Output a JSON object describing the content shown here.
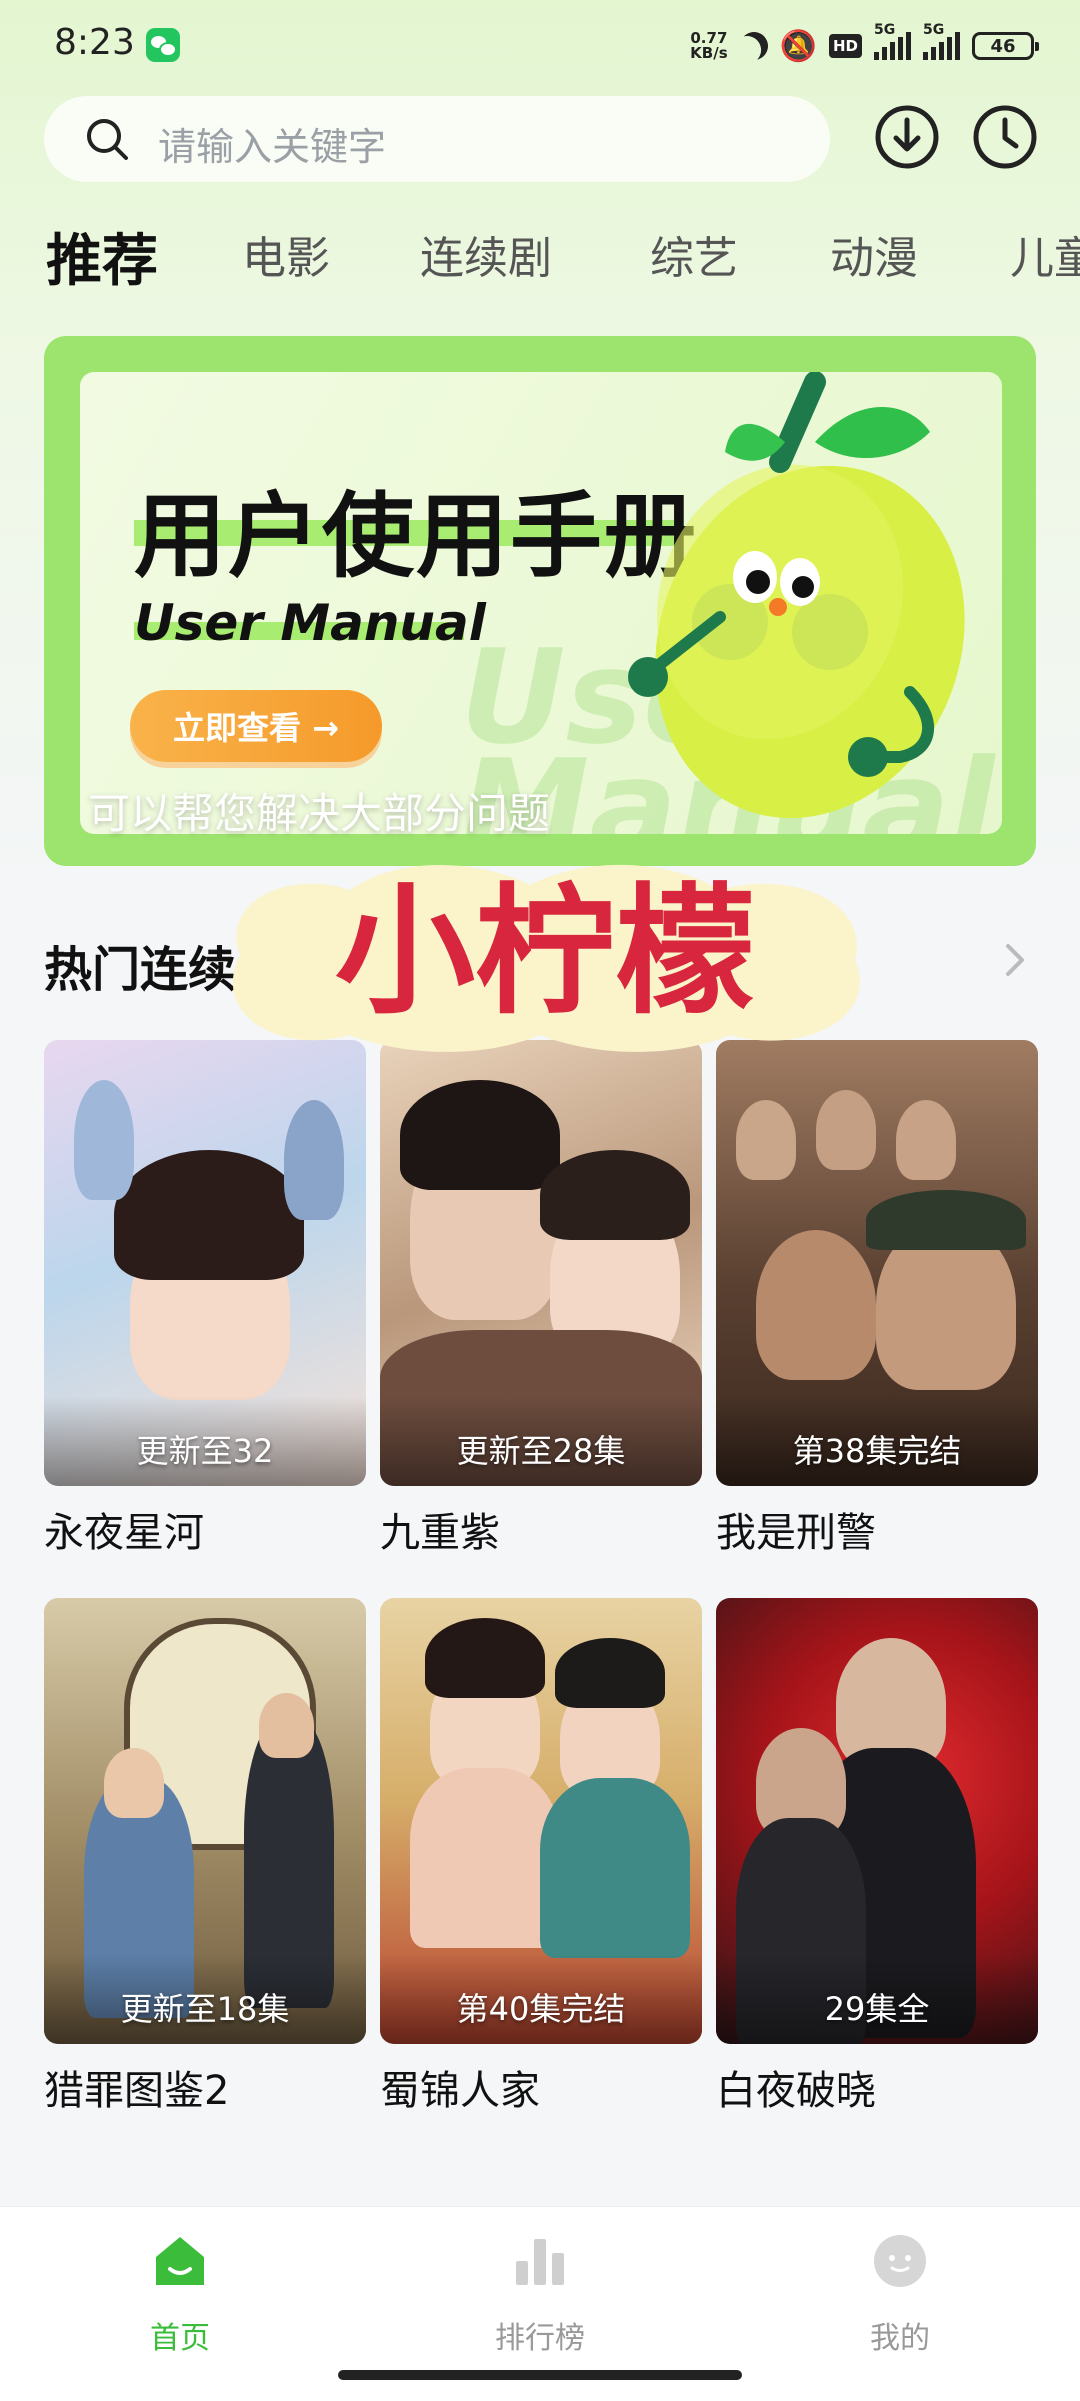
{
  "status_bar": {
    "time": "8:23",
    "net_speed_value": "0.77",
    "net_speed_unit": "KB/s",
    "hd_badge": "HD",
    "sim1": "5G",
    "sim2": "5G",
    "battery": "46"
  },
  "search": {
    "placeholder": "请输入关键字"
  },
  "header_actions": {
    "download_icon": "download-icon",
    "history_icon": "clock-icon"
  },
  "tabs": [
    {
      "label": "推荐",
      "active": true
    },
    {
      "label": "电影",
      "active": false
    },
    {
      "label": "连续剧",
      "active": false
    },
    {
      "label": "综艺",
      "active": false
    },
    {
      "label": "动漫",
      "active": false
    },
    {
      "label": "儿童",
      "active": false
    }
  ],
  "banner": {
    "title": "用户使用手册",
    "subtitle": "User Manual",
    "ghost_text_1": "User",
    "ghost_text_2": "Manual",
    "button_label": "立即查看 →",
    "caption": "可以帮您解决大部分问题",
    "accent_color": "#9de46e"
  },
  "watermark_sticker": {
    "text": "小柠檬"
  },
  "section": {
    "title": "热门连续剧"
  },
  "shows": [
    {
      "title": "永夜星河",
      "badge": "更新至32",
      "poster_colors": [
        "#d9c7e8",
        "#8fb6d9",
        "#f3d7c9"
      ]
    },
    {
      "title": "九重紫",
      "badge": "更新至28集",
      "poster_colors": [
        "#c9a88c",
        "#6b4a3a",
        "#efd8c3"
      ]
    },
    {
      "title": "我是刑警",
      "badge": "第38集完结",
      "poster_colors": [
        "#7a5a45",
        "#3d2b20",
        "#a88468"
      ]
    },
    {
      "title": "猎罪图鉴2",
      "badge": "更新至18集",
      "poster_colors": [
        "#c5b48f",
        "#6e5a3d",
        "#e9dcc0"
      ]
    },
    {
      "title": "蜀锦人家",
      "badge": "第40集完结",
      "poster_colors": [
        "#d8b270",
        "#b8432f",
        "#e9d3a4"
      ]
    },
    {
      "title": "白夜破晓",
      "badge": "29集全",
      "poster_colors": [
        "#c81e24",
        "#2a1517",
        "#8b1015"
      ]
    }
  ],
  "bottom_nav": [
    {
      "label": "首页",
      "icon": "home-icon",
      "active": true
    },
    {
      "label": "排行榜",
      "icon": "ranking-icon",
      "active": false
    },
    {
      "label": "我的",
      "icon": "profile-icon",
      "active": false
    }
  ],
  "colors": {
    "brand_green": "#3bbd3b",
    "sticker_red": "#d7263d"
  }
}
